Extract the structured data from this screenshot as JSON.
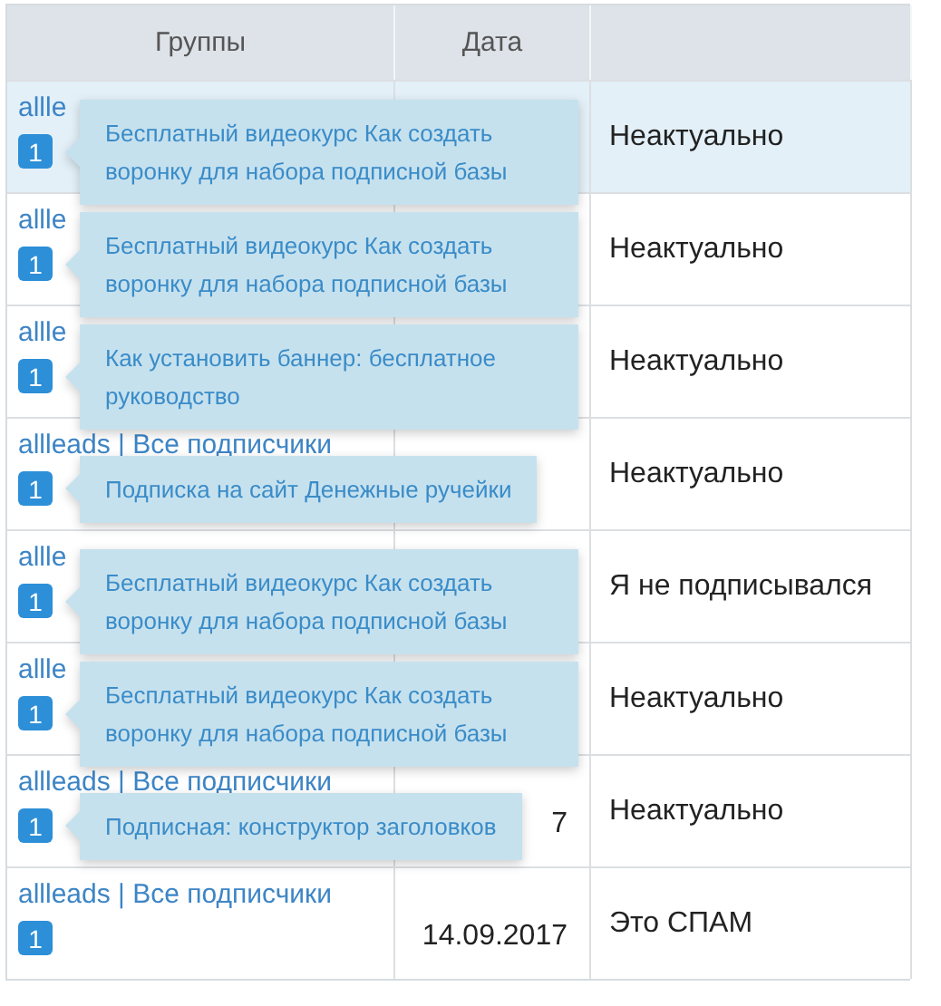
{
  "table": {
    "columns": [
      "Группы",
      "Дата",
      ""
    ],
    "rows": [
      {
        "group": "allle",
        "count": "1",
        "tooltip": "Бесплатный видеокурс Как создать воронку для набора подписной базы",
        "status": "Неактуально",
        "selected": true
      },
      {
        "group": "allle",
        "count": "1",
        "tooltip": "Бесплатный видеокурс Как создать воронку для набора подписной базы",
        "status": "Неактуально",
        "selected": false
      },
      {
        "group": "allle",
        "count": "1",
        "tooltip": "Как установить баннер: бесплатное руководство",
        "status": "Неактуально",
        "selected": false
      },
      {
        "group": "allleads | Все подписчики",
        "count": "1",
        "tooltip": "Подписка на сайт Денежные ручейки",
        "status": "Неактуально",
        "selected": false
      },
      {
        "group": "allle",
        "count": "1",
        "tooltip": "Бесплатный видеокурс Как создать воронку для набора подписной базы",
        "status": "Я не подписывался",
        "selected": false
      },
      {
        "group": "allle",
        "count": "1",
        "tooltip": "Бесплатный видеокурс Как создать воронку для набора подписной базы",
        "status": "Неактуально",
        "selected": false
      },
      {
        "group": "allleads | Все подписчики",
        "count": "1",
        "tooltip": "Подписная: конструктор заголовков",
        "date": "7",
        "status": "Неактуально",
        "selected": false
      },
      {
        "group": "allleads | Все подписчики",
        "count": "1",
        "date": "14.09.2017",
        "status": "Это СПАМ",
        "selected": false
      }
    ]
  }
}
